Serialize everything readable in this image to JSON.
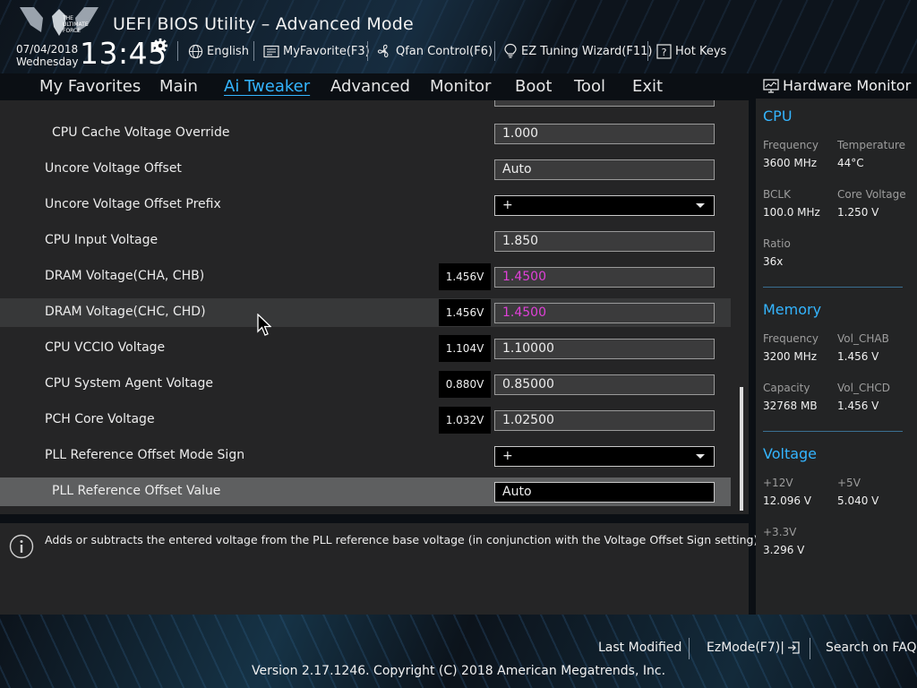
{
  "header": {
    "title": "UEFI BIOS Utility – Advanced Mode",
    "logo_text": [
      "THE",
      "ULTIMATE",
      "FORCE"
    ],
    "date": "07/04/2018",
    "weekday": "Wednesday",
    "time": "13:45",
    "items": [
      {
        "label": "English",
        "icon": "globe-icon"
      },
      {
        "label": "MyFavorite(F3)",
        "icon": "favorite-icon"
      },
      {
        "label": "Qfan Control(F6)",
        "icon": "fan-icon"
      },
      {
        "label": "EZ Tuning Wizard(F11)",
        "icon": "bulb-icon"
      },
      {
        "label": "Hot Keys",
        "icon": "question-icon"
      }
    ]
  },
  "tabs": [
    {
      "label": "My Favorites",
      "active": false
    },
    {
      "label": "Main",
      "active": false
    },
    {
      "label": "Ai Tweaker",
      "active": true
    },
    {
      "label": "Advanced",
      "active": false
    },
    {
      "label": "Monitor",
      "active": false
    },
    {
      "label": "Boot",
      "active": false
    },
    {
      "label": "Tool",
      "active": false
    },
    {
      "label": "Exit",
      "active": false
    }
  ],
  "settings": [
    {
      "label": "CPU Cache Voltage Override",
      "reading": "",
      "value": "1.000"
    },
    {
      "label": "Uncore Voltage Offset",
      "reading": "",
      "value": "Auto"
    },
    {
      "label": "Uncore Voltage Offset Prefix",
      "reading": "",
      "value": "+"
    },
    {
      "label": "CPU Input Voltage",
      "reading": "",
      "value": "1.850"
    },
    {
      "label": "DRAM Voltage(CHA, CHB)",
      "reading": "1.456V",
      "value": "1.4500"
    },
    {
      "label": "DRAM Voltage(CHC, CHD)",
      "reading": "1.456V",
      "value": "1.4500"
    },
    {
      "label": "CPU VCCIO Voltage",
      "reading": "1.104V",
      "value": "1.10000"
    },
    {
      "label": "CPU System Agent Voltage",
      "reading": "0.880V",
      "value": "0.85000"
    },
    {
      "label": "PCH Core Voltage",
      "reading": "1.032V",
      "value": "1.02500"
    },
    {
      "label": "PLL Reference Offset Mode Sign",
      "reading": "",
      "value": "+"
    },
    {
      "label": "PLL Reference Offset Value",
      "reading": "",
      "value": "Auto"
    }
  ],
  "help": {
    "text": "Adds or subtracts the entered voltage from the PLL reference base voltage (in conjunction with the Voltage Offset Sign setting)."
  },
  "hardware_monitor": {
    "title": "Hardware Monitor",
    "cpu": {
      "title": "CPU",
      "frequency_label": "Frequency",
      "frequency": "3600 MHz",
      "temperature_label": "Temperature",
      "temperature": "44°C",
      "bclk_label": "BCLK",
      "bclk": "100.0 MHz",
      "core_voltage_label": "Core Voltage",
      "core_voltage": "1.250 V",
      "ratio_label": "Ratio",
      "ratio": "36x"
    },
    "memory": {
      "title": "Memory",
      "frequency_label": "Frequency",
      "frequency": "3200 MHz",
      "vol_chab_label": "Vol_CHAB",
      "vol_chab": "1.456 V",
      "capacity_label": "Capacity",
      "capacity": "32768 MB",
      "vol_chcd_label": "Vol_CHCD",
      "vol_chcd": "1.456 V"
    },
    "voltage": {
      "title": "Voltage",
      "v12_label": "+12V",
      "v12": "12.096 V",
      "v5_label": "+5V",
      "v5": "5.040 V",
      "v33_label": "+3.3V",
      "v33": "3.296 V"
    }
  },
  "footer": {
    "last_modified": "Last Modified",
    "ezmode": "EzMode(F7)|",
    "search_faq": "Search on FAQ",
    "copyright": "Version 2.17.1246. Copyright (C) 2018 American Megatrends, Inc."
  },
  "colors": {
    "accent": "#34b5ff",
    "changed_value": "#e040d8"
  }
}
